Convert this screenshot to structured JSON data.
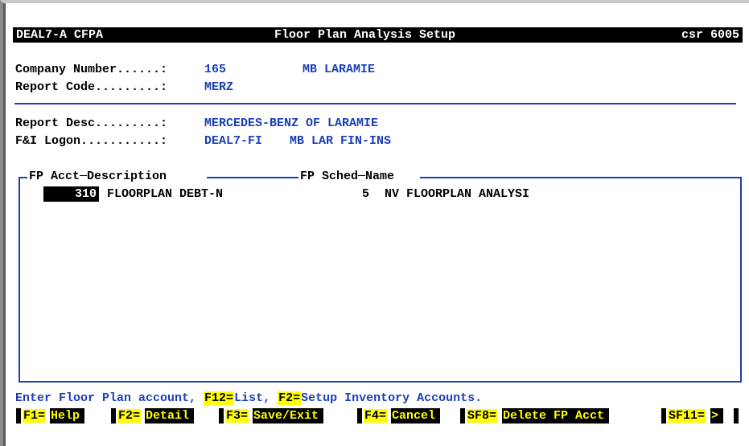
{
  "header": {
    "session": "DEAL7-A CFPA",
    "title": "Floor Plan Analysis Setup",
    "screen_id": "csr 6005"
  },
  "fields": {
    "company_number_label": "Company Number......:",
    "company_number_value": "165",
    "company_name": "MB LARAMIE",
    "report_code_label": "Report Code.........:",
    "report_code_value": "MERZ",
    "report_desc_label": "Report Desc.........:",
    "report_desc_value": "MERCEDES-BENZ OF LARAMIE",
    "fi_logon_label": "F&I Logon...........:",
    "fi_logon_value": "DEAL7-FI",
    "fi_logon_name": "MB LAR FIN-INS"
  },
  "table": {
    "col1_header": "FP Acct─Description",
    "col2_header": "FP Sched─Name",
    "rows": [
      {
        "acct": "310",
        "description": "FLOORPLAN DEBT-N",
        "sched": "5",
        "name": "NV FLOORPLAN ANALYSI"
      }
    ]
  },
  "status_line": {
    "prefix": "Enter Floor Plan account, ",
    "key1": "F12=",
    "key1_text": "List, ",
    "key2": "F2=",
    "key2_text": "Setup Inventory Accounts."
  },
  "function_keys": [
    {
      "key": "F1=",
      "label": "Help"
    },
    {
      "key": "F2=",
      "label": "Detail"
    },
    {
      "key": "F3=",
      "label": "Save/Exit"
    },
    {
      "key": "F4=",
      "label": "Cancel"
    },
    {
      "key": "SF8=",
      "label": "Delete FP Acct"
    },
    {
      "key": "SF11=",
      "label": ">"
    }
  ],
  "colors": {
    "field_text": "#1a3fb4",
    "label_text": "#000000",
    "highlight": "#ffff00",
    "title_bar": "#000000"
  }
}
